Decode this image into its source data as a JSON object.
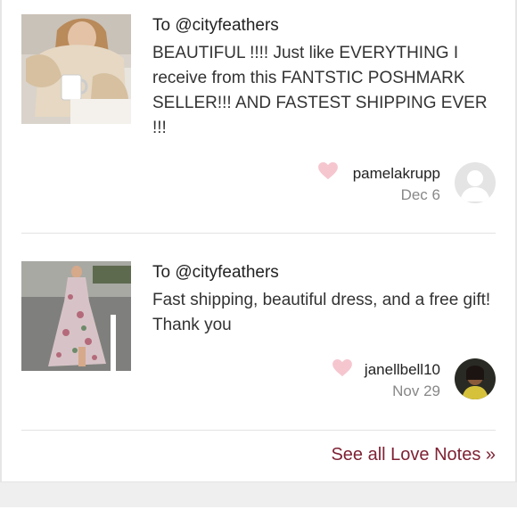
{
  "notes": [
    {
      "to": "To @cityfeathers",
      "message": "BEAUTIFUL !!!! Just like EVERYTHING I receive from this FANTSTIC POSHMARK SELLER!!! AND FASTEST SHIPPING EVER !!!",
      "author": "pamelakrupp",
      "date": "Dec 6",
      "heart_color": "#f6c6cf",
      "avatar": "default-avatar-icon"
    },
    {
      "to": "To @cityfeathers",
      "message": "Fast shipping, beautiful dress, and a free gift! Thank you",
      "author": "janellbell10",
      "date": "Nov 29",
      "heart_color": "#f6c6cf",
      "avatar": "user-photo"
    }
  ],
  "see_all": "See all Love Notes »",
  "colors": {
    "link": "#7f2234",
    "divider": "#e2e2e2",
    "muted": "#888888"
  }
}
